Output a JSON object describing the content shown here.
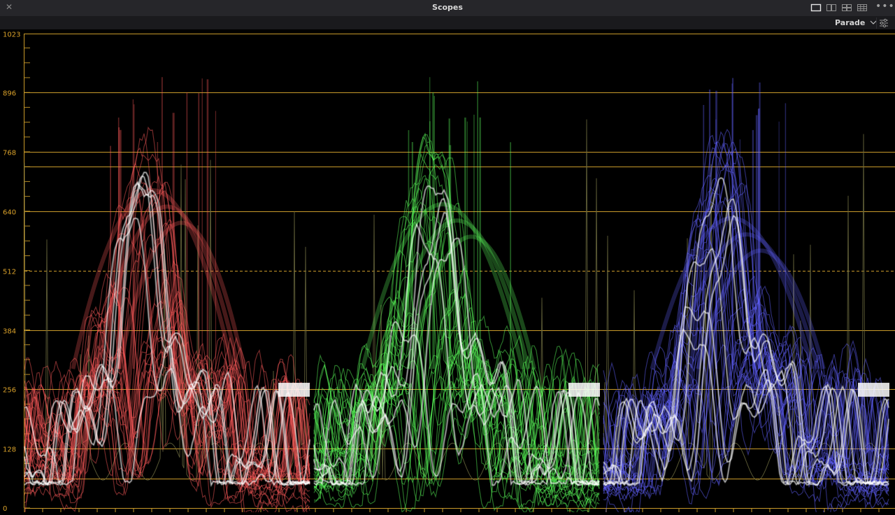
{
  "window": {
    "title": "Scopes",
    "close_icon": "close-icon",
    "more_icon": "more-icon"
  },
  "layout_buttons": [
    {
      "name": "single-view",
      "active": true
    },
    {
      "name": "dual-view",
      "active": false
    },
    {
      "name": "quad-view",
      "active": false
    },
    {
      "name": "grid-view",
      "active": false
    }
  ],
  "toolbar": {
    "scope_mode": "Parade",
    "mode_chevron_icon": "chevron-down-icon",
    "settings_icon": "sliders-icon"
  },
  "scope": {
    "y_labels": [
      "1023",
      "896",
      "768",
      "640",
      "512",
      "384",
      "256",
      "128",
      "0"
    ],
    "y_values": [
      1023,
      896,
      768,
      640,
      512,
      384,
      256,
      128,
      0
    ],
    "extra_guide_values": [
      736,
      64
    ],
    "dashed_value": 512,
    "channels": [
      {
        "name": "red",
        "color": "#ff5a5a"
      },
      {
        "name": "green",
        "color": "#5cff5c"
      },
      {
        "name": "blue",
        "color": "#6262ff"
      }
    ],
    "grid_color": "#c89a2a"
  }
}
